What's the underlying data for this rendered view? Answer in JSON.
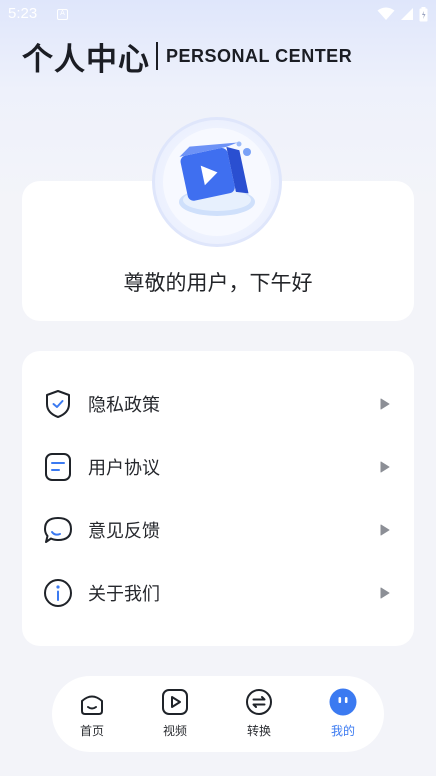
{
  "status_bar": {
    "time": "5:23",
    "notification_icon": "a-badge-icon",
    "icons": [
      "wifi-icon",
      "signal-icon",
      "battery-icon"
    ]
  },
  "header": {
    "title_cn": "个人中心",
    "title_en": "PERSONAL CENTER"
  },
  "profile": {
    "avatar": "video-cube-logo",
    "greeting": "尊敬的用户，下午好"
  },
  "menu": {
    "items": [
      {
        "label": "隐私政策",
        "icon": "shield-check-icon"
      },
      {
        "label": "用户协议",
        "icon": "document-icon"
      },
      {
        "label": "意见反馈",
        "icon": "chat-bubble-icon"
      },
      {
        "label": "关于我们",
        "icon": "info-icon"
      }
    ]
  },
  "tabbar": {
    "tabs": [
      {
        "label": "首页",
        "icon": "home-smile-icon",
        "active": false
      },
      {
        "label": "视频",
        "icon": "play-icon",
        "active": false
      },
      {
        "label": "转换",
        "icon": "swap-icon",
        "active": false
      },
      {
        "label": "我的",
        "icon": "profile-face-icon",
        "active": true
      }
    ]
  },
  "colors": {
    "accent": "#3b7af1",
    "icon_stroke": "#1f2329",
    "background": "#f3f4f9",
    "card": "#ffffff"
  }
}
